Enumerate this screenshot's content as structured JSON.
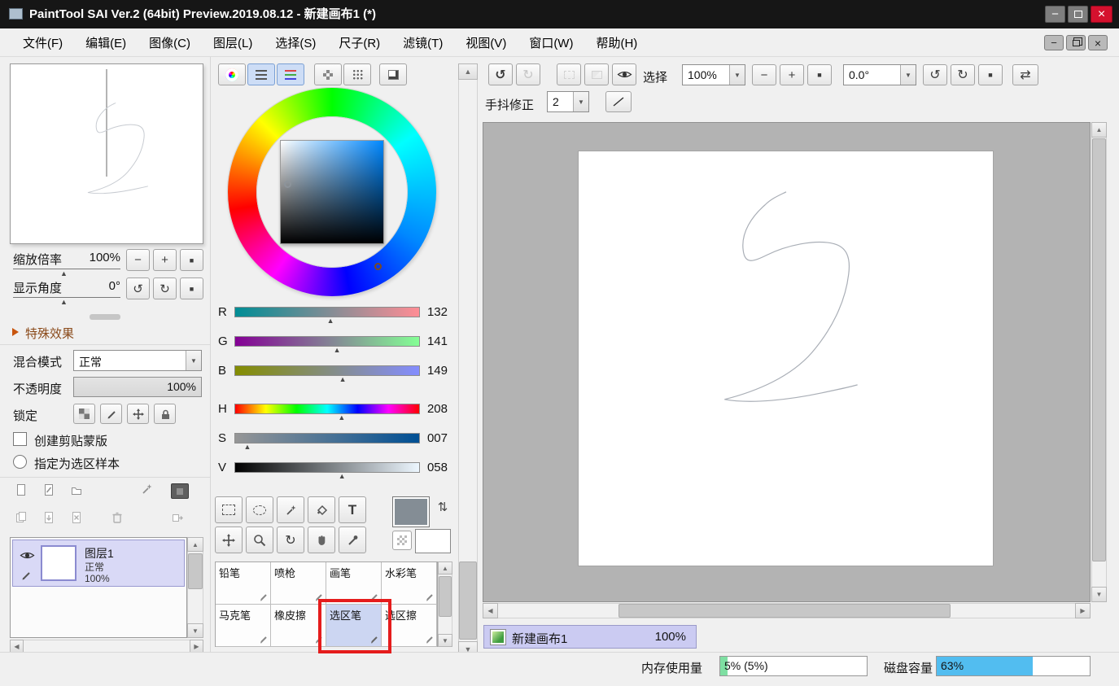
{
  "titlebar": {
    "title": "PaintTool SAI Ver.2 (64bit) Preview.2019.08.12 - 新建画布1 (*)"
  },
  "menubar": {
    "items": [
      "文件(F)",
      "编辑(E)",
      "图像(C)",
      "图层(L)",
      "选择(S)",
      "尺子(R)",
      "滤镜(T)",
      "视图(V)",
      "窗口(W)",
      "帮助(H)"
    ]
  },
  "navigator": {
    "zoom_label": "缩放倍率",
    "zoom_value": "100%",
    "angle_label": "显示角度",
    "angle_value": "0°"
  },
  "left_panel": {
    "special_effects_label": "特殊效果",
    "blend_label": "混合模式",
    "blend_value": "正常",
    "opacity_label": "不透明度",
    "opacity_value": "100%",
    "lock_label": "锁定",
    "clip_mask_label": "创建剪贴蒙版",
    "selection_source_label": "指定为选区样本"
  },
  "layers": [
    {
      "name": "图层1",
      "mode": "正常",
      "opacity": "100%"
    }
  ],
  "color_panel": {
    "current_color": "#848D95",
    "secondary_color": "#FFFFFF",
    "sliders": [
      {
        "ch": "R",
        "value": "132",
        "pos": "51.8%"
      },
      {
        "ch": "G",
        "value": "141",
        "pos": "55.3%"
      },
      {
        "ch": "B",
        "value": "149",
        "pos": "58.4%"
      },
      {
        "ch": "H",
        "value": "208",
        "pos": "57.8%"
      },
      {
        "ch": "S",
        "value": "007",
        "pos": "7%"
      },
      {
        "ch": "V",
        "value": "058",
        "pos": "58%"
      }
    ]
  },
  "tools": {
    "text_tool_glyph": "T",
    "selected_tool": "选区笔",
    "cells": [
      {
        "label": "铅笔"
      },
      {
        "label": "喷枪"
      },
      {
        "label": "画笔"
      },
      {
        "label": "水彩笔"
      },
      {
        "label": "马克笔"
      },
      {
        "label": "橡皮擦"
      },
      {
        "label": "选区笔",
        "selected": true
      },
      {
        "label": "选区擦"
      }
    ]
  },
  "canvas_toolbar": {
    "selection_label": "选择",
    "zoom_value": "100%",
    "angle_value": "0.0°",
    "stabilizer_label": "手抖修正",
    "stabilizer_value": "2"
  },
  "canvas_tab": {
    "name": "新建画布1",
    "zoom": "100%"
  },
  "statusbar": {
    "memory_label": "内存使用量",
    "memory_text": "5% (5%)",
    "memory_fill": "5%",
    "memory_color": "#7EDFA2",
    "disk_label": "磁盘容量",
    "disk_text": "63%",
    "disk_fill": "63%",
    "disk_color": "#52BDF0"
  },
  "icons": {
    "minimize": "−",
    "close": "×",
    "undo": "↺",
    "redo": "↻",
    "flip": "⇄",
    "dropdown": "▼",
    "up": "▲",
    "down": "▼",
    "left": "◀",
    "right": "▶",
    "plus": "+",
    "minus": "−",
    "stop": "■",
    "swap": "⇅",
    "rotate_ccw": "↺",
    "rotate_cw": "↻",
    "marker": "▲"
  }
}
